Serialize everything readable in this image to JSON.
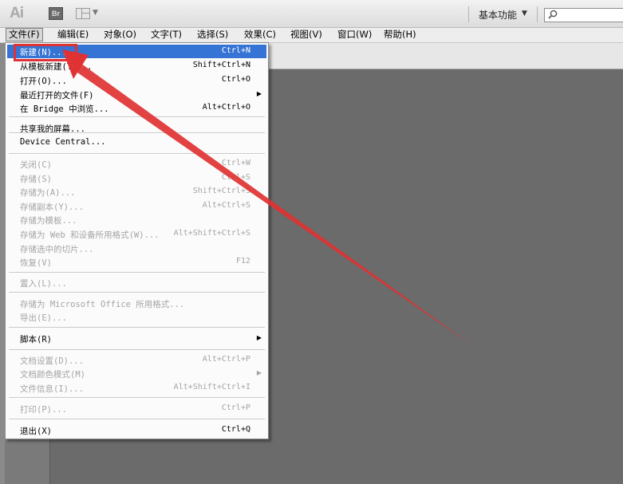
{
  "app": {
    "logo": "Ai",
    "bridge_icon": "Br"
  },
  "workspace": {
    "label": "基本功能"
  },
  "search": {
    "value": ""
  },
  "menubar": {
    "items": [
      "文件(F)",
      "编辑(E)",
      "对象(O)",
      "文字(T)",
      "选择(S)",
      "效果(C)",
      "视图(V)",
      "窗口(W)",
      "帮助(H)"
    ],
    "active": "文件(F)"
  },
  "file_menu": {
    "items": [
      {
        "label": "新建(N)...",
        "shortcut": "Ctrl+N",
        "state": "highlighted"
      },
      {
        "label": "从模板新建(T)...",
        "shortcut": "Shift+Ctrl+N",
        "state": "enabled"
      },
      {
        "label": "打开(O)...",
        "shortcut": "Ctrl+O",
        "state": "enabled"
      },
      {
        "label": "最近打开的文件(F)",
        "shortcut": "",
        "state": "enabled",
        "submenu": true
      },
      {
        "label": "在 Bridge 中浏览...",
        "shortcut": "Alt+Ctrl+O",
        "state": "enabled"
      },
      {
        "label": "共享我的屏幕...",
        "shortcut": "",
        "state": "enabled"
      },
      {
        "label": "Device Central...",
        "shortcut": "",
        "state": "enabled"
      },
      {
        "label": "关闭(C)",
        "shortcut": "Ctrl+W",
        "state": "disabled"
      },
      {
        "label": "存储(S)",
        "shortcut": "Ctrl+S",
        "state": "disabled"
      },
      {
        "label": "存储为(A)...",
        "shortcut": "Shift+Ctrl+S",
        "state": "disabled"
      },
      {
        "label": "存储副本(Y)...",
        "shortcut": "Alt+Ctrl+S",
        "state": "disabled"
      },
      {
        "label": "存储为模板...",
        "shortcut": "",
        "state": "disabled"
      },
      {
        "label": "存储为 Web 和设备所用格式(W)...",
        "shortcut": "Alt+Shift+Ctrl+S",
        "state": "disabled"
      },
      {
        "label": "存储选中的切片...",
        "shortcut": "",
        "state": "disabled"
      },
      {
        "label": "恢复(V)",
        "shortcut": "F12",
        "state": "disabled"
      },
      {
        "label": "置入(L)...",
        "shortcut": "",
        "state": "disabled"
      },
      {
        "label": "存储为 Microsoft Office 所用格式...",
        "shortcut": "",
        "state": "disabled"
      },
      {
        "label": "导出(E)...",
        "shortcut": "",
        "state": "disabled"
      },
      {
        "label": "脚本(R)",
        "shortcut": "",
        "state": "enabled",
        "submenu": true
      },
      {
        "label": "文档设置(D)...",
        "shortcut": "Alt+Ctrl+P",
        "state": "disabled"
      },
      {
        "label": "文档颜色模式(M)",
        "shortcut": "",
        "state": "disabled",
        "submenu": true
      },
      {
        "label": "文件信息(I)...",
        "shortcut": "Alt+Shift+Ctrl+I",
        "state": "disabled"
      },
      {
        "label": "打印(P)...",
        "shortcut": "Ctrl+P",
        "state": "disabled"
      },
      {
        "label": "退出(X)",
        "shortcut": "Ctrl+Q",
        "state": "enabled"
      }
    ]
  },
  "colors": {
    "highlight": "#3574d4",
    "annotation": "#e03232",
    "canvas": "#6b6b6b"
  }
}
